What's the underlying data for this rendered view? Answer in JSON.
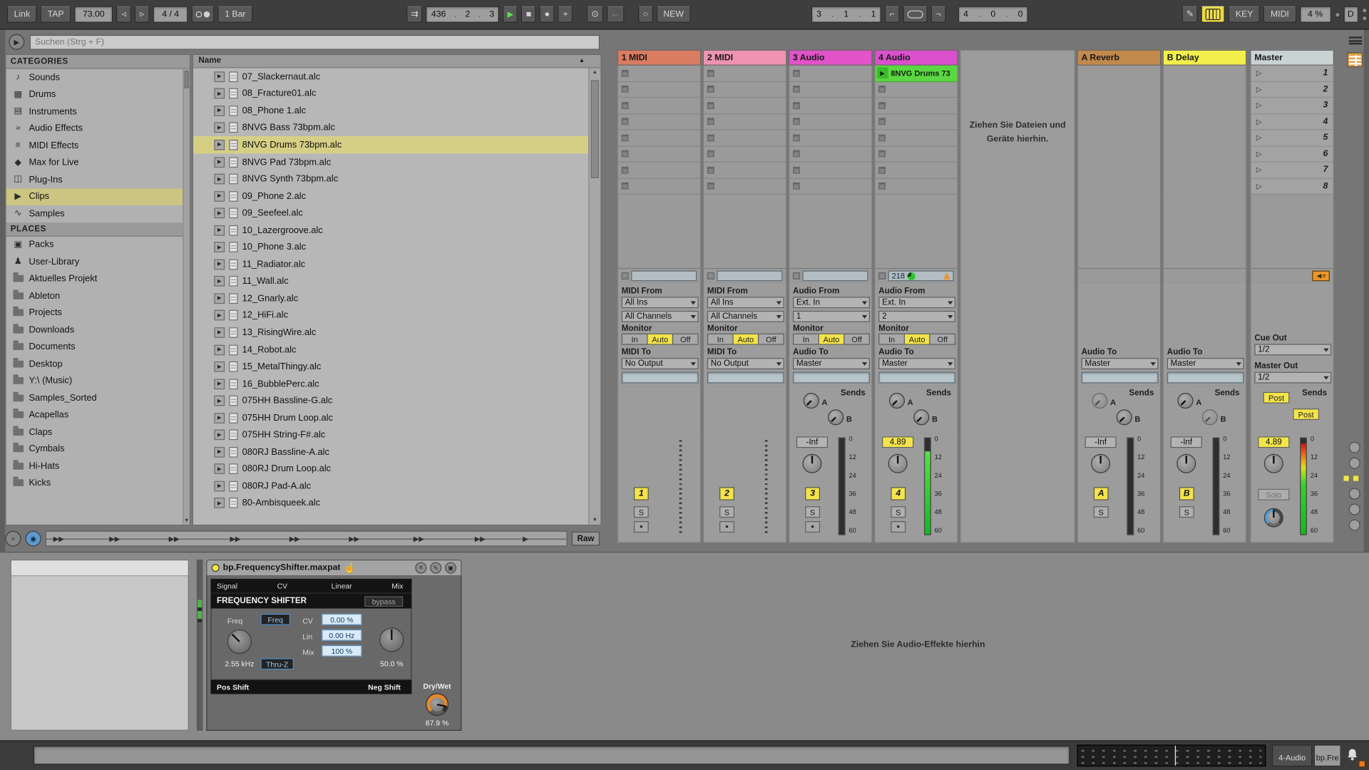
{
  "icons": {
    "nudge_down": "◃",
    "nudge_up": "▹",
    "follow": "⇉",
    "play": "▶",
    "stop": "■",
    "record": "●",
    "overdub": "+",
    "automation_arm": "⊙",
    "reenable_automation": "←",
    "session_record": "○",
    "punch_in": "⌐",
    "punch_out": "¬",
    "draw": "✎",
    "scene_launch": "▷",
    "clip_play": "▶",
    "back_to_arrangement": "◀",
    "sort_asc": "▲",
    "scroll_up": "▲",
    "scroll_down": "▼",
    "file_preview": "▶",
    "hand": "☝",
    "rec_dot": "●",
    "browser_play": "▶",
    "wave": "≈",
    "speaker_dot": "◉",
    "dev_menu": "≡",
    "dev_edit": "✎",
    "dev_save": "▣"
  },
  "toolbar": {
    "link": "Link",
    "tap": "TAP",
    "tempo": "73.00",
    "time_sig": "4 / 4",
    "quantize": "1 Bar",
    "position": [
      "436",
      "2",
      "3"
    ],
    "loop_start": [
      "3",
      "1",
      "1"
    ],
    "loop_length": [
      "4",
      "0",
      "0"
    ],
    "new_button": "NEW",
    "key_button": "KEY",
    "midi_button": "MIDI",
    "cpu": "4 %",
    "disk": "D"
  },
  "browser": {
    "search_placeholder": "Suchen (Strg + F)",
    "categories_title": "CATEGORIES",
    "categories": [
      {
        "label": "Sounds",
        "icon": "note-icon",
        "glyph": "♪"
      },
      {
        "label": "Drums",
        "icon": "drum-pad-icon",
        "glyph": "▦"
      },
      {
        "label": "Instruments",
        "icon": "keys-icon",
        "glyph": "▤"
      },
      {
        "label": "Audio Effects",
        "icon": "audio-fx-icon",
        "glyph": "≈"
      },
      {
        "label": "MIDI Effects",
        "icon": "midi-fx-icon",
        "glyph": "≡"
      },
      {
        "label": "Max for Live",
        "icon": "max-icon",
        "glyph": "◆"
      },
      {
        "label": "Plug-Ins",
        "icon": "plug-icon",
        "glyph": "◫"
      },
      {
        "label": "Clips",
        "icon": "clip-icon",
        "glyph": "▶",
        "selected": true
      },
      {
        "label": "Samples",
        "icon": "wave-icon",
        "glyph": "∿"
      }
    ],
    "places_title": "PLACES",
    "places": [
      {
        "label": "Packs",
        "icon": "pack-icon",
        "glyph": "▣"
      },
      {
        "label": "User-Library",
        "icon": "user-icon",
        "glyph": "♟"
      },
      {
        "label": "Aktuelles Projekt",
        "icon": "folder-icon",
        "glyph": ""
      },
      {
        "label": "Ableton",
        "icon": "folder-icon",
        "glyph": ""
      },
      {
        "label": "Projects",
        "icon": "folder-icon",
        "glyph": ""
      },
      {
        "label": "Downloads",
        "icon": "folder-icon",
        "glyph": ""
      },
      {
        "label": "Documents",
        "icon": "folder-icon",
        "glyph": ""
      },
      {
        "label": "Desktop",
        "icon": "folder-icon",
        "glyph": ""
      },
      {
        "label": "Y:\\ (Music)",
        "icon": "folder-icon",
        "glyph": ""
      },
      {
        "label": "Samples_Sorted",
        "icon": "folder-icon",
        "glyph": ""
      },
      {
        "label": "Acapellas",
        "icon": "folder-icon",
        "glyph": ""
      },
      {
        "label": "Claps",
        "icon": "folder-icon",
        "glyph": ""
      },
      {
        "label": "Cymbals",
        "icon": "folder-icon",
        "glyph": ""
      },
      {
        "label": "Hi-Hats",
        "icon": "folder-icon",
        "glyph": ""
      },
      {
        "label": "Kicks",
        "icon": "folder-icon",
        "glyph": ""
      }
    ],
    "name_header": "Name",
    "files": [
      "07_Slackernaut.alc",
      "08_Fracture01.alc",
      "08_Phone 1.alc",
      "8NVG Bass 73bpm.alc",
      "8NVG Drums 73bpm.alc",
      "8NVG Pad 73bpm.alc",
      "8NVG Synth 73bpm.alc",
      "09_Phone 2.alc",
      "09_Seefeel.alc",
      "10_Lazergroove.alc",
      "10_Phone 3.alc",
      "11_Radiator.alc",
      "11_Wall.alc",
      "12_Gnarly.alc",
      "12_HiFi.alc",
      "13_RisingWire.alc",
      "14_Robot.alc",
      "15_MetalThingy.alc",
      "16_BubblePerc.alc",
      "075HH Bassline-G.alc",
      "075HH Drum Loop.alc",
      "075HH String-F#.alc",
      "080RJ Bassline-A.alc",
      "080RJ Drum Loop.alc",
      "080RJ Pad-A.alc",
      "80-Ambisqueek.alc"
    ],
    "selected_index": 4,
    "raw_button": "Raw"
  },
  "session": {
    "drop_hint": "Ziehen Sie Dateien und Geräte hierhin.",
    "scenes": [
      "1",
      "2",
      "3",
      "4",
      "5",
      "6",
      "7",
      "8"
    ],
    "sends_label": "Sends",
    "send_a": "A",
    "send_b": "B",
    "monitor_label": "Monitor",
    "monitor_options": [
      "In",
      "Auto",
      "Off"
    ],
    "meter_scale": [
      "0",
      "12",
      "24",
      "36",
      "48",
      "60"
    ],
    "tracks": [
      {
        "name": "1 MIDI",
        "num": "1",
        "solo": "S",
        "color": "#d97c62",
        "from_label": "MIDI From",
        "input": "All Ins",
        "channel": "All Channels",
        "to_label": "MIDI To",
        "output": "No Output"
      },
      {
        "name": "2 MIDI",
        "num": "2",
        "solo": "S",
        "color": "#ef93b2",
        "from_label": "MIDI From",
        "input": "All Ins",
        "channel": "All Channels",
        "to_label": "MIDI To",
        "output": "No Output"
      },
      {
        "name": "3 Audio",
        "num": "3",
        "solo": "S",
        "color": "#e253c8",
        "from_label": "Audio From",
        "input": "Ext. In",
        "channel": "1",
        "to_label": "Audio To",
        "output": "Master",
        "volume": "-Inf",
        "meter_fill": 0
      },
      {
        "name": "4 Audio",
        "num": "4",
        "solo": "S",
        "color": "#da50cd",
        "from_label": "Audio From",
        "input": "Ext. In",
        "channel": "2",
        "to_label": "Audio To",
        "output": "Master",
        "volume": "4.89",
        "meter_fill": 0.86,
        "clip_name": "8NVG Drums 73",
        "status_count": "218"
      },
      {
        "name": "A Reverb",
        "num": "A",
        "solo": "S",
        "color": "#c2894c",
        "to_label": "Audio To",
        "output": "Master",
        "volume": "-Inf",
        "meter_fill": 0
      },
      {
        "name": "B Delay",
        "num": "B",
        "solo": "S",
        "color": "#f2ef4c",
        "to_label": "Audio To",
        "output": "Master",
        "volume": "-Inf",
        "meter_fill": 0
      },
      {
        "name": "Master",
        "color": "#c9d3d3",
        "cue_label": "Cue Out",
        "cue_out": "1/2",
        "out_label": "Master Out",
        "master_out": "1/2",
        "post_a": "Post",
        "post_b": "Post",
        "solo_label": "Solo",
        "volume": "4.89",
        "meter_fill": 0.95
      }
    ]
  },
  "device": {
    "title": "bp.FrequencyShifter.maxpat",
    "headers": [
      "Signal",
      "CV",
      "Linear",
      "Mix"
    ],
    "device_name": "FREQUENCY SHIFTER",
    "bypass": "bypass",
    "freq_label": "Freq",
    "freq_toggle": "Freq",
    "freq_value": "2.55 kHz",
    "thru_toggle": "Thru-Z",
    "cv_label": "CV",
    "cv_value": "0.00 %",
    "lin_label": "Lin",
    "lin_value": "0.00 Hz",
    "mix_label": "Mix",
    "mix_value": "100 %",
    "mix_knob_value": "50.0 %",
    "pos_shift": "Pos Shift",
    "neg_shift": "Neg Shift",
    "drywet_label": "Dry/Wet",
    "drywet_value": "87.9 %",
    "drop_hint": "Ziehen Sie Audio-Effekte hierhin"
  },
  "statusbar": {
    "tab_track": "4-Audio",
    "tab_device": "bp.Fre"
  }
}
